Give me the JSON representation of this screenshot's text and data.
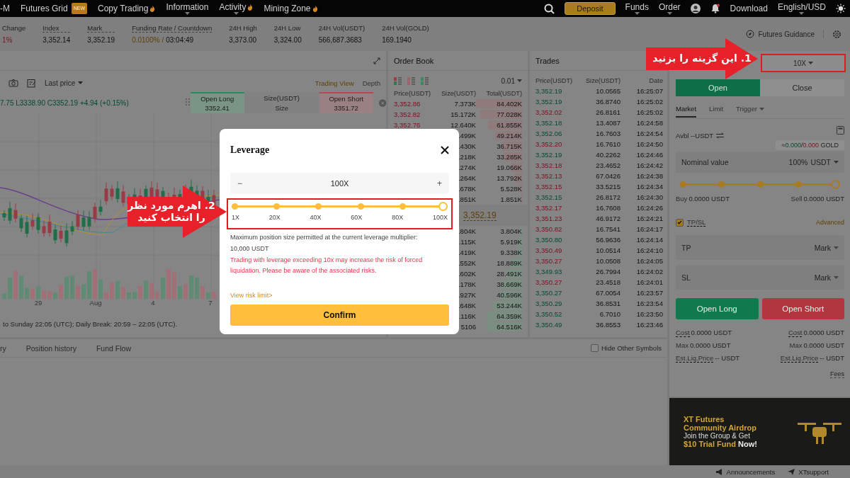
{
  "nav": {
    "items": [
      {
        "label": "-M",
        "hot": false,
        "dropdown": false
      },
      {
        "label": "Futures Grid",
        "badge": "NEW",
        "hot": false,
        "dropdown": false
      },
      {
        "label": "Copy Trading",
        "hot": true,
        "dropdown": false
      },
      {
        "label": "Information",
        "hot": false,
        "dropdown": true
      },
      {
        "label": "Activity",
        "hot": true,
        "dropdown": true
      },
      {
        "label": "Mining Zone",
        "hot": true,
        "dropdown": false
      }
    ],
    "deposit": "Deposit",
    "right_items": [
      {
        "label": "Funds",
        "dropdown": true
      },
      {
        "label": "Order",
        "dropdown": true
      }
    ],
    "download": "Download",
    "language": "English/USD"
  },
  "ticker": [
    {
      "label": "Change",
      "value": "1%",
      "negative": true,
      "highlight": false,
      "underlined": false
    },
    {
      "label": "Index",
      "value": "3,352.14",
      "negative": false,
      "highlight": false,
      "underlined": true
    },
    {
      "label": "Mark",
      "value": "3,352.19",
      "negative": false,
      "highlight": false,
      "underlined": true
    },
    {
      "label": "Funding Rate / Countdown",
      "value": "0.0100% /",
      "value_2": "03:04:49",
      "negative": false,
      "highlight": true,
      "underlined": true
    },
    {
      "label": "24H High",
      "value": "3,373.00",
      "negative": false,
      "highlight": false,
      "underlined": false
    },
    {
      "label": "24H Low",
      "value": "3,324.00",
      "negative": false,
      "highlight": false,
      "underlined": false
    },
    {
      "label": "24H Vol(USDT)",
      "value": "566,687.3683",
      "negative": false,
      "highlight": false,
      "underlined": false
    },
    {
      "label": "24H Vol(GOLD)",
      "value": "169.1940",
      "negative": false,
      "highlight": false,
      "underlined": false
    }
  ],
  "guidance": "Futures Guidance",
  "chart": {
    "last_price": "Last price",
    "views": [
      {
        "label": "Trading View",
        "selected": true
      },
      {
        "label": "Depth",
        "selected": false
      }
    ],
    "ohlc": "7.75 L3338.90 C3352.19 +4.94 (+0.15%)",
    "quick_trade": {
      "long_label": "Open Long",
      "long_price": "3352.41",
      "size_label": "Size(USDT)",
      "size_placeholder": "Size",
      "short_label": "Open Short",
      "short_price": "3351.72"
    },
    "x_labels": [
      "29",
      "Aug",
      "4",
      "7"
    ],
    "notice": "to Sunday 22:05 (UTC); Daily Break: 20:59 – 22:05 (UTC)."
  },
  "positions": {
    "tabs": [
      "ry",
      "Position history",
      "Fund Flow"
    ],
    "hide_other": {
      "label": "Hide Other Symbols",
      "checked": false
    }
  },
  "order_book": {
    "title": "Order Book",
    "step": "0.01",
    "columns": [
      "Price(USDT)",
      "Size(USDT)",
      "Total(USDT)"
    ],
    "asks": [
      {
        "price": "3,352.86",
        "size": "7.373K",
        "total": "84.402K"
      },
      {
        "price": "3,352.82",
        "size": "15.172K",
        "total": "77.028K"
      },
      {
        "price": "3,352.76",
        "size": "12.640K",
        "total": "61.855K"
      },
      {
        "size": ".499K",
        "total": "49.214K"
      },
      {
        "size": ".430K",
        "total": "36.715K"
      },
      {
        "size": ".218K",
        "total": "33.285K"
      },
      {
        "size": ".274K",
        "total": "19.066K"
      },
      {
        "size": ".264K",
        "total": "13.792K"
      },
      {
        "size": ".678K",
        "total": "5.528K"
      },
      {
        "size": ".851K",
        "total": "1.851K"
      }
    ],
    "mid_price": "3,352.19",
    "bids": [
      {
        "size": ".804K",
        "total": "3.804K"
      },
      {
        "size": ".115K",
        "total": "5.919K"
      },
      {
        "size": ".419K",
        "total": "9.338K"
      },
      {
        "size": ".552K",
        "total": "18.889K"
      },
      {
        "size": ".602K",
        "total": "28.491K"
      },
      {
        "size": ".178K",
        "total": "38.669K"
      },
      {
        "size": ".927K",
        "total": "40.596K"
      },
      {
        "size": ".648K",
        "total": "53.244K"
      },
      {
        "size": ".116K",
        "total": "64.359K"
      },
      {
        "size": "5106",
        "total": "64.516K"
      }
    ]
  },
  "trades": {
    "title": "Trades",
    "columns": [
      "Price(USDT)",
      "Size(USDT)",
      "Date"
    ],
    "rows": [
      {
        "price": "3,352.19",
        "buy": true,
        "size": "10.0565",
        "time": "16:25:07"
      },
      {
        "price": "3,352.19",
        "buy": true,
        "size": "36.8740",
        "time": "16:25:02"
      },
      {
        "price": "3,352.02",
        "buy": false,
        "size": "26.8161",
        "time": "16:25:02"
      },
      {
        "price": "3,352.18",
        "buy": true,
        "size": "13.4087",
        "time": "16:24:58"
      },
      {
        "price": "3,352.06",
        "buy": true,
        "size": "16.7603",
        "time": "16:24:54"
      },
      {
        "price": "3,352.20",
        "buy": false,
        "size": "16.7610",
        "time": "16:24:50"
      },
      {
        "price": "3,352.19",
        "buy": true,
        "size": "40.2262",
        "time": "16:24:46"
      },
      {
        "price": "3,352.18",
        "buy": false,
        "size": "23.4652",
        "time": "16:24:42"
      },
      {
        "price": "3,352.13",
        "buy": false,
        "size": "67.0426",
        "time": "16:24:38"
      },
      {
        "price": "3,352.15",
        "buy": false,
        "size": "33.5215",
        "time": "16:24:34"
      },
      {
        "price": "3,352.15",
        "buy": true,
        "size": "26.8172",
        "time": "16:24:30"
      },
      {
        "price": "3,352.17",
        "buy": false,
        "size": "16.7608",
        "time": "16:24:26"
      },
      {
        "price": "3,351.23",
        "buy": false,
        "size": "46.9172",
        "time": "16:24:21"
      },
      {
        "price": "3,350.82",
        "buy": false,
        "size": "16.7541",
        "time": "16:24:17"
      },
      {
        "price": "3,350.80",
        "buy": true,
        "size": "56.9636",
        "time": "16:24:14"
      },
      {
        "price": "3,350.49",
        "buy": false,
        "size": "10.0514",
        "time": "16:24:10"
      },
      {
        "price": "3,350.27",
        "buy": false,
        "size": "10.0508",
        "time": "16:24:05"
      },
      {
        "price": "3,349.93",
        "buy": true,
        "size": "26.7994",
        "time": "16:24:02"
      },
      {
        "price": "3,350.27",
        "buy": false,
        "size": "23.4518",
        "time": "16:24:01"
      },
      {
        "price": "3,350.27",
        "buy": true,
        "size": "67.0054",
        "time": "16:23:57"
      },
      {
        "price": "3,350.29",
        "buy": true,
        "size": "36.8531",
        "time": "16:23:54"
      },
      {
        "price": "3,350.52",
        "buy": true,
        "size": "6.7010",
        "time": "16:23:50"
      },
      {
        "price": "3,350.49",
        "buy": true,
        "size": "36.8553",
        "time": "16:23:46"
      }
    ]
  },
  "order_panel": {
    "leverage": "10X",
    "side_tabs": [
      {
        "label": "Open",
        "selected": true
      },
      {
        "label": "Close",
        "selected": false
      }
    ],
    "type_tabs": [
      {
        "label": "Market",
        "selected": true,
        "dropdown": false
      },
      {
        "label": "Limit",
        "selected": false,
        "dropdown": false
      },
      {
        "label": "Trigger",
        "selected": false,
        "dropdown": true
      }
    ],
    "avbl_label": "Avbl",
    "avbl_value": "--USDT",
    "tooltip": {
      "prefix": "≈",
      "long": "0.000",
      "separator": "/",
      "short": "0.000",
      "unit": "GOLD"
    },
    "nominal": {
      "placeholder": "Nominal value",
      "percent": "100%",
      "unit": "USDT"
    },
    "slider": {
      "level": 1
    },
    "buy_label": "Buy",
    "buy_value": "0.0000 USDT",
    "sell_label": "Sell",
    "sell_value": "0.0000 USDT",
    "tpsl": {
      "label": "TP/SL",
      "checked": true,
      "advanced": "Advanced"
    },
    "fields": [
      {
        "label": "TP",
        "trigger": "Mark"
      },
      {
        "label": "SL",
        "trigger": "Mark"
      }
    ],
    "open_long": "Open Long",
    "open_short": "Open Short",
    "summary_long": [
      {
        "label": "Cost",
        "value": "0.0000 USDT",
        "underlined": true
      },
      {
        "label": "Max",
        "value": "0.0000 USDT",
        "underlined": false
      },
      {
        "label": "Est.Liq.Price",
        "value": "-- USDT",
        "underlined": true
      }
    ],
    "summary_short": [
      {
        "label": "Cost",
        "value": "0.0000 USDT",
        "underlined": true
      },
      {
        "label": "Max",
        "value": "0.0000 USDT",
        "underlined": false
      },
      {
        "label": "Est.Liq.Price",
        "value": "-- USDT",
        "underlined": true
      }
    ],
    "fees": "Fees"
  },
  "promo": {
    "lines": [
      "XT Futures",
      "Community Airdrop",
      "Join the Group & Get"
    ],
    "highlight": "$10 Trial Fund",
    "tail": "Now!"
  },
  "footer": {
    "announcements": "Announcements",
    "support": "XTsupport"
  },
  "leverage_modal": {
    "title": "Leverage",
    "minus": "−",
    "value": "100X",
    "plus": "+",
    "slider": {
      "level": 1,
      "ticks": [
        "1X",
        "20X",
        "40X",
        "60X",
        "80X",
        "100X"
      ]
    },
    "max_text": "Maximum position size permitted at the current leverage multiplier:",
    "max_value": "10,000 USDT",
    "warning": "Trading with leverage exceeding 10x may increase the risk of forced liquidation. Please be aware of the associated risks.",
    "risk_link": "View risk limit>",
    "confirm": "Confirm"
  },
  "annotations": [
    {
      "lines": [
        "1. این گزینه را بزنید"
      ]
    },
    {
      "lines": [
        "2. اهرم مورد نظر",
        "را انتخاب کنید"
      ]
    }
  ]
}
